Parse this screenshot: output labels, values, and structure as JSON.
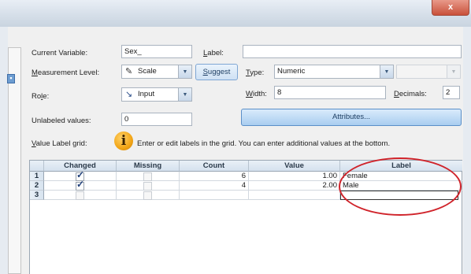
{
  "window": {
    "close_label": "x"
  },
  "form": {
    "current_variable_label": "Current Variable:",
    "current_variable_value": "Sex_",
    "label_label": "Label:",
    "label_value": "",
    "measurement_label": "Measurement Level:",
    "measurement_value": "Scale",
    "suggest_label": "Suggest",
    "type_label": "Type:",
    "type_value": "Numeric",
    "role_label": "Role:",
    "role_value": "Input",
    "width_label": "Width:",
    "width_value": "8",
    "decimals_label": "Decimals:",
    "decimals_value": "2",
    "unlabeled_label": "Unlabeled values:",
    "unlabeled_value": "0",
    "attributes_label": "Attributes...",
    "grid_caption": "Value Label grid:",
    "grid_hint": "Enter or edit labels in the grid. You can enter additional values at the bottom."
  },
  "grid": {
    "columns": [
      "Changed",
      "Missing",
      "Count",
      "Value",
      "Label"
    ],
    "rows": [
      {
        "num": "1",
        "changed": true,
        "missing": false,
        "count": "6",
        "value": "1.00",
        "label": "Female"
      },
      {
        "num": "2",
        "changed": true,
        "missing": false,
        "count": "4",
        "value": "2.00",
        "label": "Male"
      },
      {
        "num": "3",
        "changed": false,
        "missing": false,
        "count": "",
        "value": "",
        "label": ""
      }
    ]
  },
  "annotation": {
    "color": "#d0232a",
    "shape": "ellipse around Label column"
  },
  "icons": {
    "info": "info-icon",
    "measure": "ruler-icon",
    "role": "input-arrow-icon"
  }
}
